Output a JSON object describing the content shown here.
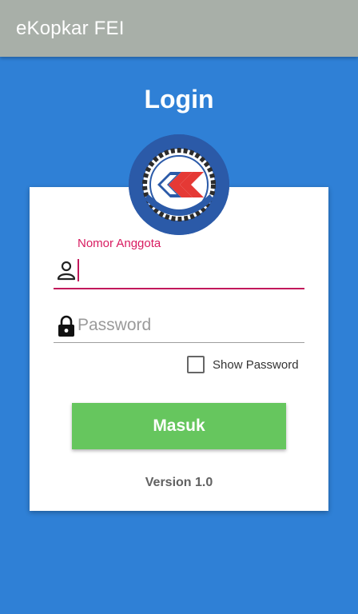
{
  "appbar": {
    "title": "eKopkar FEI"
  },
  "page": {
    "title": "Login"
  },
  "form": {
    "member_label": "Nomor Anggota",
    "member_value": "",
    "password_placeholder": "Password",
    "password_value": "",
    "show_password_label": "Show Password",
    "show_password_checked": false,
    "submit_label": "Masuk"
  },
  "footer": {
    "version": "Version 1.0"
  },
  "colors": {
    "background": "#2F80D6",
    "appbar": "#A8AFA8",
    "accent": "#C2185B",
    "button": "#66C65E"
  },
  "icons": {
    "logo": "koperasi-logo",
    "member": "person-icon",
    "password": "lock-icon"
  }
}
